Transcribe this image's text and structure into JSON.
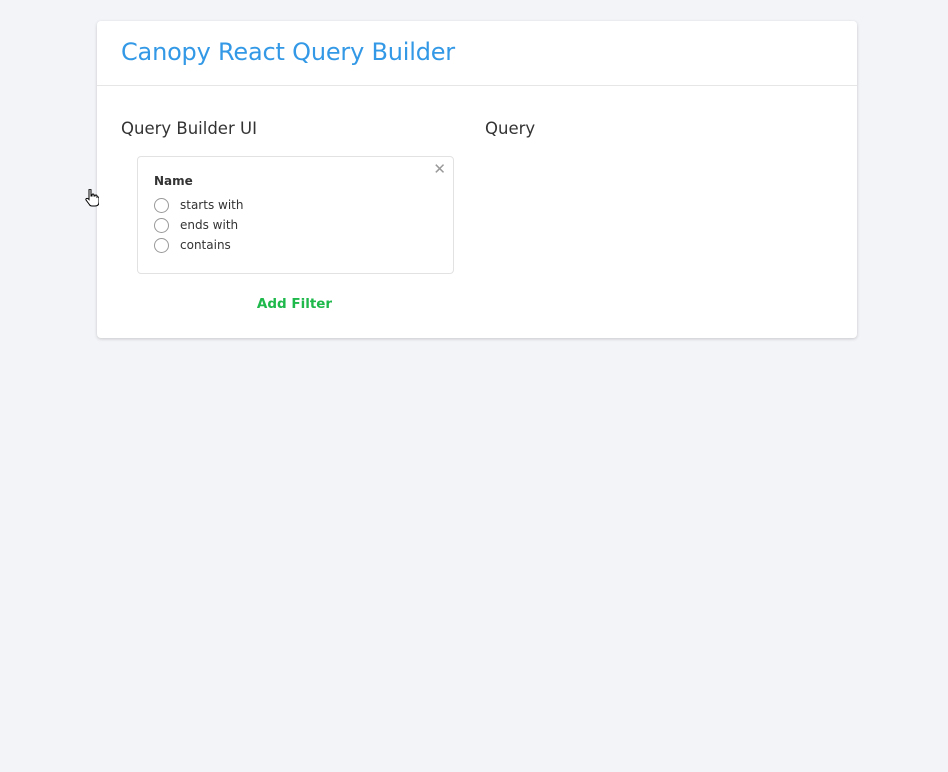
{
  "app": {
    "title": "Canopy React Query Builder"
  },
  "columns": {
    "builder_heading": "Query Builder UI",
    "query_heading": "Query"
  },
  "filter": {
    "name": "Name",
    "close_icon": "close-icon",
    "options": [
      {
        "label": "starts with",
        "selected": false
      },
      {
        "label": "ends with",
        "selected": false
      },
      {
        "label": "contains",
        "selected": false
      }
    ]
  },
  "actions": {
    "add_filter_label": "Add Filter"
  },
  "colors": {
    "title": "#3399e6",
    "add_filter": "#1eb84b",
    "background": "#f3f4f8"
  }
}
